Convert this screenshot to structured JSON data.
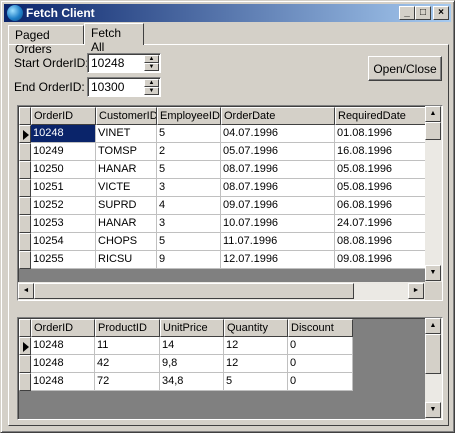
{
  "window": {
    "title": "Fetch Client",
    "controls": {
      "minimize": "_",
      "maximize": "□",
      "close": "×"
    }
  },
  "tabs": [
    {
      "label": "Paged Orders"
    },
    {
      "label": "Fetch All"
    }
  ],
  "filters": {
    "start_label": "Start OrderID:",
    "start_value": "10248",
    "end_label": "End OrderID:",
    "end_value": "10300"
  },
  "open_close_button": "Open/Close",
  "icons": {
    "row_indicator": "triangle-right",
    "scroll_up": "▲",
    "scroll_down": "▼",
    "scroll_left": "◄",
    "scroll_right": "►"
  },
  "orders_grid": {
    "columns": [
      "OrderID",
      "CustomerID",
      "EmployeeID",
      "OrderDate",
      "RequiredDate"
    ],
    "rows": [
      [
        "10248",
        "VINET",
        "5",
        "04.07.1996",
        "01.08.1996"
      ],
      [
        "10249",
        "TOMSP",
        "2",
        "05.07.1996",
        "16.08.1996"
      ],
      [
        "10250",
        "HANAR",
        "5",
        "08.07.1996",
        "05.08.1996"
      ],
      [
        "10251",
        "VICTE",
        "3",
        "08.07.1996",
        "05.08.1996"
      ],
      [
        "10252",
        "SUPRD",
        "4",
        "09.07.1996",
        "06.08.1996"
      ],
      [
        "10253",
        "HANAR",
        "3",
        "10.07.1996",
        "24.07.1996"
      ],
      [
        "10254",
        "CHOPS",
        "5",
        "11.07.1996",
        "08.08.1996"
      ],
      [
        "10255",
        "RICSU",
        "9",
        "12.07.1996",
        "09.08.1996"
      ]
    ]
  },
  "details_grid": {
    "columns": [
      "OrderID",
      "ProductID",
      "UnitPrice",
      "Quantity",
      "Discount"
    ],
    "rows": [
      [
        "10248",
        "11",
        "14",
        "12",
        "0"
      ],
      [
        "10248",
        "42",
        "9,8",
        "12",
        "0"
      ],
      [
        "10248",
        "72",
        "34,8",
        "5",
        "0"
      ]
    ]
  }
}
